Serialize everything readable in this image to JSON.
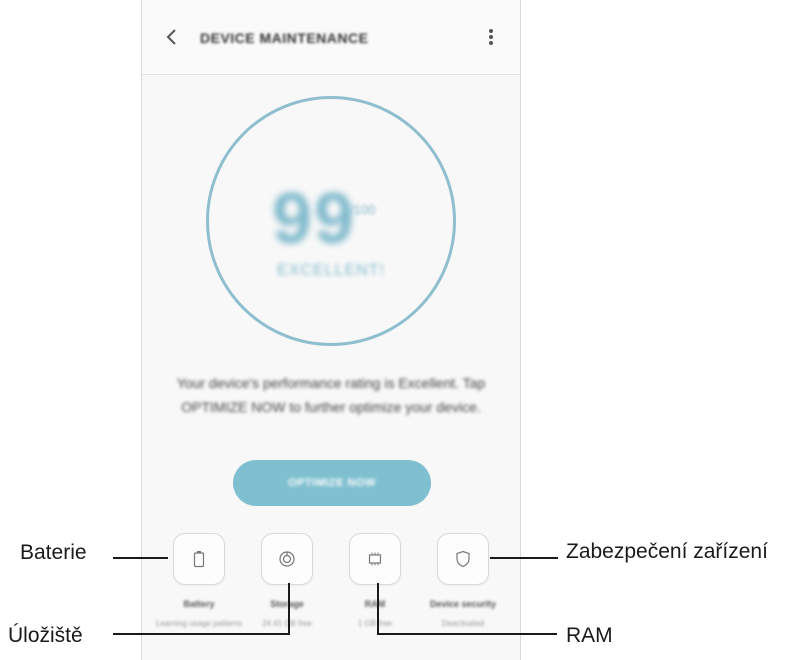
{
  "screen": {
    "title": "DEVICE MAINTENANCE",
    "score": {
      "value": "99",
      "max": "/100",
      "status": "EXCELLENT!"
    },
    "message": "Your device's performance rating is Excellent. Tap OPTIMIZE NOW to further optimize your device.",
    "optimize_button": "OPTIMIZE NOW",
    "tiles": [
      {
        "label": "Battery",
        "sub": "Learning usage patterns",
        "icon": "battery-icon"
      },
      {
        "label": "Storage",
        "sub": "24.41 GB free",
        "icon": "storage-icon"
      },
      {
        "label": "RAM",
        "sub": "1 GB free",
        "icon": "ram-icon"
      },
      {
        "label": "Device security",
        "sub": "Deactivated",
        "icon": "shield-icon"
      }
    ]
  },
  "callouts": {
    "battery": "Baterie",
    "storage": "Úložiště",
    "ram": "RAM",
    "security": "Zabezpečení zařízení"
  },
  "colors": {
    "accent": "#7fbfcf",
    "ring": "#8fbfcf",
    "background": "#f8f8f8"
  }
}
